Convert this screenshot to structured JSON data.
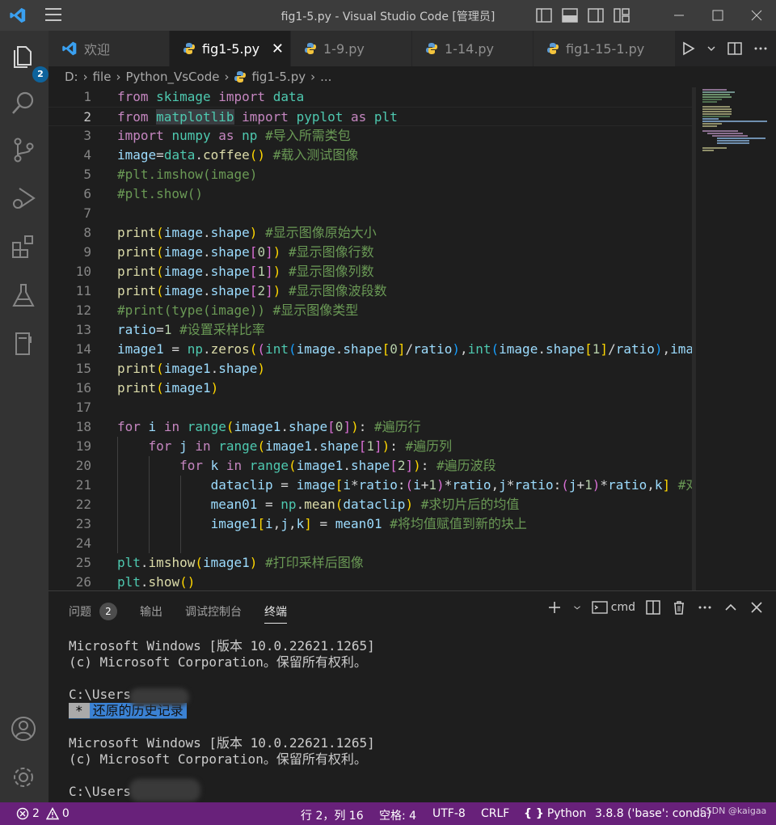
{
  "window": {
    "title": "fig1-5.py - Visual Studio Code [管理员]"
  },
  "activity": {
    "explorer_badge": "2"
  },
  "tabs": [
    {
      "label": "欢迎",
      "icon": "vscode-logo-icon"
    },
    {
      "label": "fig1-5.py",
      "icon": "python-file-icon",
      "active": true,
      "close": "✕"
    },
    {
      "label": "1-9.py",
      "icon": "python-file-icon"
    },
    {
      "label": "1-14.py",
      "icon": "python-file-icon"
    },
    {
      "label": "fig1-15-1.py",
      "icon": "python-file-icon"
    }
  ],
  "breadcrumb": {
    "drive": "D:",
    "folder1": "file",
    "folder2": "Python_VsCode",
    "file": "fig1-5.py",
    "more": "..."
  },
  "editor": {
    "current_line": 2,
    "lines": [
      "1",
      "2",
      "3",
      "4",
      "5",
      "6",
      "7",
      "8",
      "9",
      "10",
      "11",
      "12",
      "13",
      "14",
      "15",
      "16",
      "17",
      "18",
      "19",
      "20",
      "21",
      "22",
      "23",
      "24",
      "25",
      "26"
    ],
    "comments": {
      "c3": "#导入所需类包",
      "c4": "#载入测试图像",
      "c5": "#plt.imshow(image)",
      "c6": "#plt.show()",
      "c8": "#显示图像原始大小",
      "c9": "#显示图像行数",
      "c10": "#显示图像列数",
      "c11": "#显示图像波段数",
      "c12": "#print(type(image)) #显示图像类型",
      "c13": "#设置采样比率",
      "c18": "#遍历行",
      "c19": "#遍历列",
      "c20": "#遍历波段",
      "c21": "#对",
      "c22": "#求切片后的均值",
      "c23": "#将均值赋值到新的块上",
      "c25": "#打印采样后图像"
    }
  },
  "panel": {
    "tabs": [
      {
        "label": "问题",
        "badge": "2"
      },
      {
        "label": "输出"
      },
      {
        "label": "调试控制台"
      },
      {
        "label": "终端",
        "active": true
      }
    ],
    "terminal_kind": "cmd",
    "terminal": {
      "l1": "Microsoft Windows [版本 10.0.22621.1265]",
      "l2": "(c) Microsoft Corporation。保留所有权利。",
      "l3": "C:\\Users",
      "restore_star": "*",
      "restore_text": "还原的历史记录",
      "l5": "Microsoft Windows [版本 10.0.22621.1265]",
      "l6": "(c) Microsoft Corporation。保留所有权利。",
      "l7": "C:\\Users"
    }
  },
  "status": {
    "errors": "2",
    "warnings": "0",
    "position": "行 2，列 16",
    "spaces": "空格: 4",
    "encoding": "UTF-8",
    "eol": "CRLF",
    "language": "Python",
    "interpreter": "3.8.8 ('base': conda)",
    "watermark": "CSDN @kaigaa"
  },
  "colors": {
    "statusbar": "#68217a",
    "accent": "#0e639c",
    "titlebar": "#3c3c3c"
  }
}
